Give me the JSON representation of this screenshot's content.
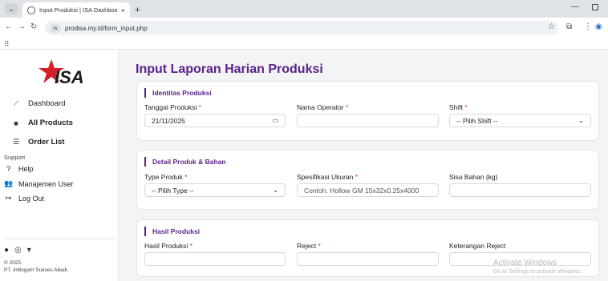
{
  "browser": {
    "tab_title": "Input Produksi | ISA Dashboard",
    "tab_close": "×",
    "new_tab": "+",
    "url": "prodisa.my.id/form_input.php"
  },
  "sidebar": {
    "nav": [
      {
        "label": "Dashboard",
        "icon": "chart-line-icon"
      },
      {
        "label": "All Products",
        "icon": "box-icon"
      },
      {
        "label": "Order List",
        "icon": "list-icon"
      }
    ],
    "support_label": "Support",
    "support_items": [
      {
        "label": "Help",
        "icon": "help-icon"
      },
      {
        "label": "Manajemen User",
        "icon": "users-icon"
      },
      {
        "label": "Log Out",
        "icon": "logout-icon"
      }
    ],
    "copyright_year": "© 2025",
    "copyright_company": "PT. Intilogam Sukses Abadi"
  },
  "page": {
    "title": "Input Laporan Harian Produksi"
  },
  "sections": {
    "identitas": {
      "title": "Identitas Produksi",
      "tanggal_label": "Tanggal Produksi",
      "tanggal_value": "21/11/2025",
      "operator_label": "Nama Operator",
      "operator_value": "",
      "shift_label": "Shift",
      "shift_value": "-- Pilih Shift --"
    },
    "detail": {
      "title": "Detail Produk & Bahan",
      "type_label": "Type Produk",
      "type_value": "-- Pilih Type --",
      "spek_label": "Spesifikasi Ukuran",
      "spek_placeholder": "Contoh: Hollow GM 15x32x0.25x4000",
      "sisa_label": "Sisa Bahan (kg)",
      "sisa_value": ""
    },
    "hasil": {
      "title": "Hasil Produksi",
      "hasil_label": "Hasil Produksi",
      "reject_label": "Reject",
      "keterangan_label": "Keterangan Reject"
    }
  },
  "required_mark": "*",
  "watermark": {
    "title": "Activate Windows",
    "subtitle": "Go to Settings to activate Windows."
  },
  "colors": {
    "brand": "#5b1f8a",
    "logo_red": "#d62027",
    "required": "#dd3333"
  }
}
